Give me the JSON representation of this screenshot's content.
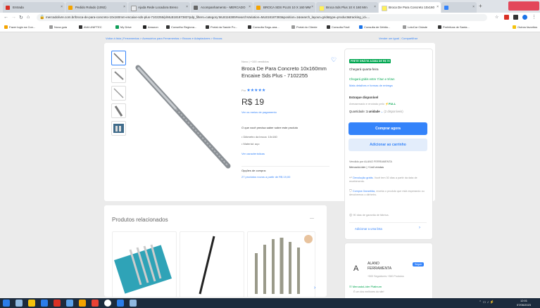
{
  "browser": {
    "tabs": [
      {
        "label": "Entrada",
        "color": "#d93025"
      },
      {
        "label": "Pedido Rolado (1092)",
        "color": "#f4a300"
      },
      {
        "label": "Ajuda Rede Locadora Breno",
        "color": "#e8eaed"
      },
      {
        "label": "Acompanhamento - MERCADO",
        "color": "#666666"
      },
      {
        "label": "BROCA SDS PLUS 10 X 160 MM",
        "color": "#f4a300"
      },
      {
        "label": "Broca Sds Plus 10 X 160 Mm",
        "color": "#fff159"
      },
      {
        "label": "Broca De Para Concreto 10x160",
        "color": "#fff159"
      },
      {
        "label": "",
        "color": "#3483fa"
      }
    ],
    "url": "mercadolivre.com.br/broca-de-para-concreto-10x160mm-encaixe-sds-plus-7102255/p/MLB18187383?pdp_filters=category:MLB116385#searchVariation=MLB18187383&position=1&search_layout=grid&type=product&tracking_id=...",
    "bookmarks": [
      "Fazer login na Con...",
      "Nova guia",
      "AVA UNIFTEC",
      "My Drive",
      "Amazon",
      "Conselho Regiona...",
      "Portal da Saúde Pu...",
      "Consulta Segu-ana...",
      "Portal do Cliente",
      "Consulta Fácil",
      "Consulta de Débito...",
      "LotoCar Cidade",
      "Prefeitura de Santa..."
    ],
    "bookmarks_other": "Outros favoritos"
  },
  "page": {
    "breadcrumb": "Voltar à lista  |  Ferramentas > Acessórios para Ferramentas > Brocas e Adaptadores > Brocas",
    "top_links": [
      "Vender um igual",
      "Compartilhar"
    ],
    "product": {
      "condition": "Novo  |  +100 vendidos",
      "title": "Broca De Para Concreto 10x160mm Encaixe Sds Plus - 7102255",
      "brand_line": "Por",
      "stars": "★★★★★",
      "price": "R$ 19",
      "payment_link": "Ver os meios de pagamento",
      "about_heading": "O que você precisa saber sobre este produto",
      "features": [
        "Diâmetro da broca: 10x160",
        "Material: aço"
      ],
      "features_link": "Ver características",
      "buy_label": "Opções de compra:",
      "buy_options": "27 produtos novos a partir de R$ 19,00",
      "favorite_icon": "heart-icon"
    },
    "buybox": {
      "badge": "FRETE GRÁTIS ACIMA DE R$ 79",
      "arrival": "Chegará quarta-feira",
      "shipping_free": "Chegará grátis entre 7/Jun e 9/Jun",
      "shipping_link": "Mais detalhes e formas de entrega",
      "stock_title": "Estoque disponível",
      "stock_sub": "Armazenado e enviado pelo",
      "full": "⚡FULL",
      "qty_label": "Quantidade:",
      "qty_value": "1 unidade",
      "qty_avail": "(2 disponíveis)",
      "buy_now": "Comprar agora",
      "add_cart": "Adicionar ao carrinho",
      "sold_by_label": "Vendido por ALANO FERRAMENTA",
      "sold_by_sub": "MercadoLíder  |  +1mil vendas",
      "benefits": [
        {
          "title": "Devolução grátis.",
          "text": "Você tem 30 dias a partir da data de recebimento."
        },
        {
          "title": "Compra Garantida,",
          "text": "receba o produto que está esperando ou devolvemos o dinheiro."
        },
        {
          "title": "",
          "text": "90 dias de garantia de fábrica."
        }
      ],
      "add_list": "Adicionar a uma lista"
    },
    "related": {
      "heading": "Produtos relacionados"
    },
    "seller": {
      "name_line1": "ALANO",
      "name_line2": "FERRAMENTA",
      "badge": "Seguir",
      "sub": "+500 Seguidores  +360 Produtos",
      "leader": "MercadoLíder Platinum",
      "leader_sub": "É um dos melhores do site!"
    }
  },
  "taskbar": {
    "time": "12:01",
    "date": "07/06/2023"
  }
}
